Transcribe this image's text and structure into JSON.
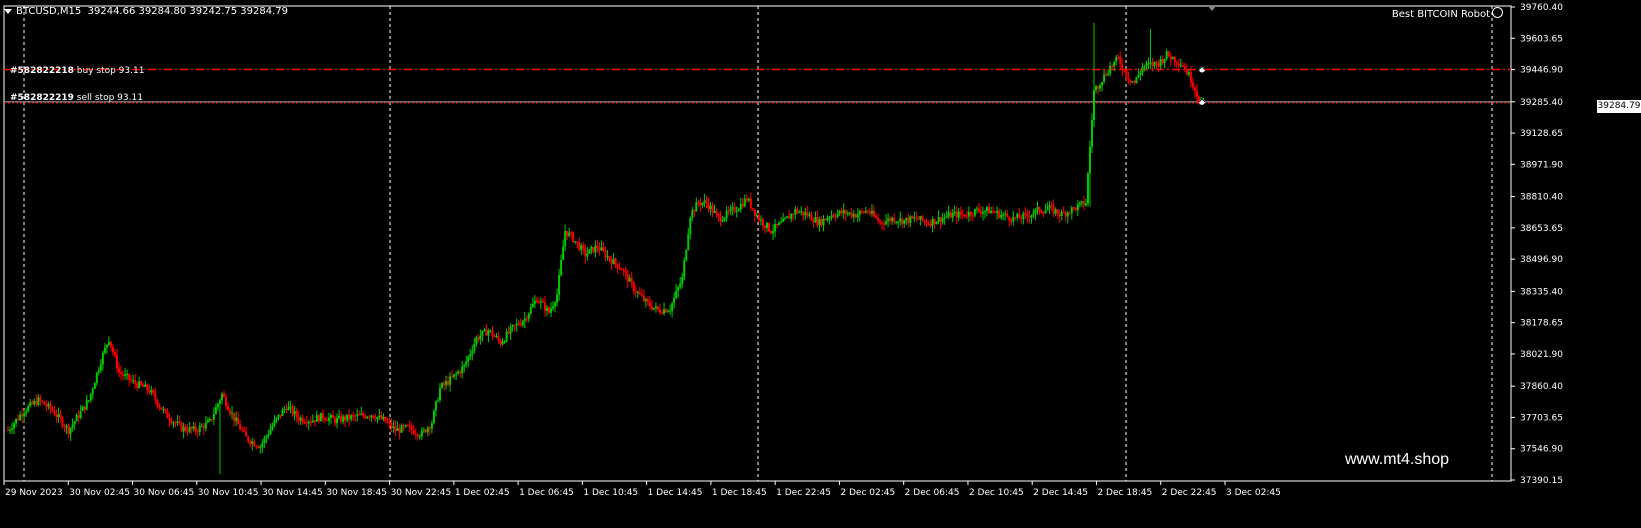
{
  "header": {
    "symbol": "BTCUSD,M15",
    "ohlc": "39244.66 39284.80 39242.75 39284.79"
  },
  "expert": {
    "name": "Best BITCOIN Robot"
  },
  "watermark": "www.mt4.shop",
  "orders": [
    {
      "ticket": "#582822218",
      "type_text": "buy stop 93.11",
      "price": 39446.9,
      "color": "#ff0000"
    },
    {
      "ticket": "#582822219",
      "type_text": "sell stop 93.11",
      "price": 39284.79,
      "color": "#ff0000"
    }
  ],
  "current_price": "39284.79",
  "colors": {
    "background": "#000000",
    "bull": "#00cc00",
    "bear": "#ff0000",
    "grid": "#ffffff",
    "text": "#ffffff"
  },
  "chart_data": {
    "type": "candlestick",
    "symbol": "BTCUSD",
    "timeframe": "M15",
    "ylim": [
      37390.15,
      39760.4
    ],
    "y_ticks": [
      "39760.40",
      "39603.65",
      "39446.90",
      "39285.40",
      "39128.65",
      "38971.90",
      "38810.40",
      "38653.65",
      "38496.90",
      "38335.40",
      "38178.65",
      "38021.90",
      "37860.40",
      "37703.65",
      "37546.90",
      "37390.15"
    ],
    "x_ticks": [
      "29 Nov 2023",
      "30 Nov 02:45",
      "30 Nov 06:45",
      "30 Nov 10:45",
      "30 Nov 14:45",
      "30 Nov 18:45",
      "30 Nov 22:45",
      "1 Dec 02:45",
      "1 Dec 06:45",
      "1 Dec 10:45",
      "1 Dec 14:45",
      "1 Dec 18:45",
      "1 Dec 22:45",
      "2 Dec 02:45",
      "2 Dec 06:45",
      "2 Dec 10:45",
      "2 Dec 14:45",
      "2 Dec 18:45",
      "2 Dec 22:45",
      "3 Dec 02:45"
    ],
    "close_path": [
      [
        0,
        37640
      ],
      [
        8,
        37740
      ],
      [
        15,
        37790
      ],
      [
        22,
        37740
      ],
      [
        30,
        37640
      ],
      [
        40,
        37790
      ],
      [
        46,
        37990
      ],
      [
        50,
        38100
      ],
      [
        55,
        37930
      ],
      [
        62,
        37880
      ],
      [
        70,
        37840
      ],
      [
        78,
        37720
      ],
      [
        86,
        37650
      ],
      [
        93,
        37640
      ],
      [
        100,
        37680
      ],
      [
        106,
        37820
      ],
      [
        112,
        37700
      ],
      [
        118,
        37600
      ],
      [
        125,
        37560
      ],
      [
        132,
        37680
      ],
      [
        138,
        37760
      ],
      [
        144,
        37700
      ],
      [
        150,
        37690
      ],
      [
        156,
        37710
      ],
      [
        162,
        37690
      ],
      [
        168,
        37700
      ],
      [
        174,
        37710
      ],
      [
        180,
        37720
      ],
      [
        186,
        37690
      ],
      [
        192,
        37640
      ],
      [
        198,
        37650
      ],
      [
        205,
        37620
      ],
      [
        210,
        37680
      ],
      [
        214,
        37850
      ],
      [
        220,
        37900
      ],
      [
        226,
        37960
      ],
      [
        232,
        38100
      ],
      [
        238,
        38140
      ],
      [
        244,
        38080
      ],
      [
        250,
        38150
      ],
      [
        256,
        38200
      ],
      [
        262,
        38300
      ],
      [
        268,
        38230
      ],
      [
        272,
        38320
      ],
      [
        276,
        38640
      ],
      [
        280,
        38600
      ],
      [
        286,
        38520
      ],
      [
        292,
        38560
      ],
      [
        298,
        38500
      ],
      [
        304,
        38450
      ],
      [
        310,
        38350
      ],
      [
        316,
        38280
      ],
      [
        322,
        38240
      ],
      [
        328,
        38250
      ],
      [
        334,
        38400
      ],
      [
        338,
        38720
      ],
      [
        342,
        38780
      ],
      [
        346,
        38780
      ],
      [
        352,
        38700
      ],
      [
        356,
        38720
      ],
      [
        362,
        38760
      ],
      [
        366,
        38800
      ],
      [
        372,
        38700
      ],
      [
        378,
        38640
      ],
      [
        384,
        38680
      ],
      [
        390,
        38740
      ],
      [
        396,
        38720
      ],
      [
        402,
        38680
      ],
      [
        408,
        38720
      ],
      [
        414,
        38730
      ],
      [
        420,
        38720
      ],
      [
        426,
        38740
      ],
      [
        432,
        38680
      ],
      [
        438,
        38700
      ],
      [
        444,
        38690
      ],
      [
        450,
        38700
      ],
      [
        456,
        38680
      ],
      [
        462,
        38700
      ],
      [
        468,
        38720
      ],
      [
        474,
        38720
      ],
      [
        480,
        38740
      ],
      [
        486,
        38740
      ],
      [
        492,
        38720
      ],
      [
        498,
        38700
      ],
      [
        504,
        38710
      ],
      [
        510,
        38740
      ],
      [
        516,
        38750
      ],
      [
        522,
        38720
      ],
      [
        528,
        38750
      ],
      [
        534,
        38780
      ],
      [
        538,
        39340
      ],
      [
        542,
        39400
      ],
      [
        546,
        39460
      ],
      [
        550,
        39500
      ],
      [
        554,
        39420
      ],
      [
        558,
        39380
      ],
      [
        562,
        39460
      ],
      [
        566,
        39470
      ],
      [
        570,
        39480
      ],
      [
        574,
        39520
      ],
      [
        578,
        39500
      ],
      [
        582,
        39470
      ],
      [
        586,
        39400
      ],
      [
        590,
        39300
      ],
      [
        592,
        39285
      ]
    ],
    "series": [
      {
        "name": "buy stop 93.11",
        "value": 39446.9
      },
      {
        "name": "sell stop 93.11",
        "value": 39284.79
      }
    ]
  }
}
